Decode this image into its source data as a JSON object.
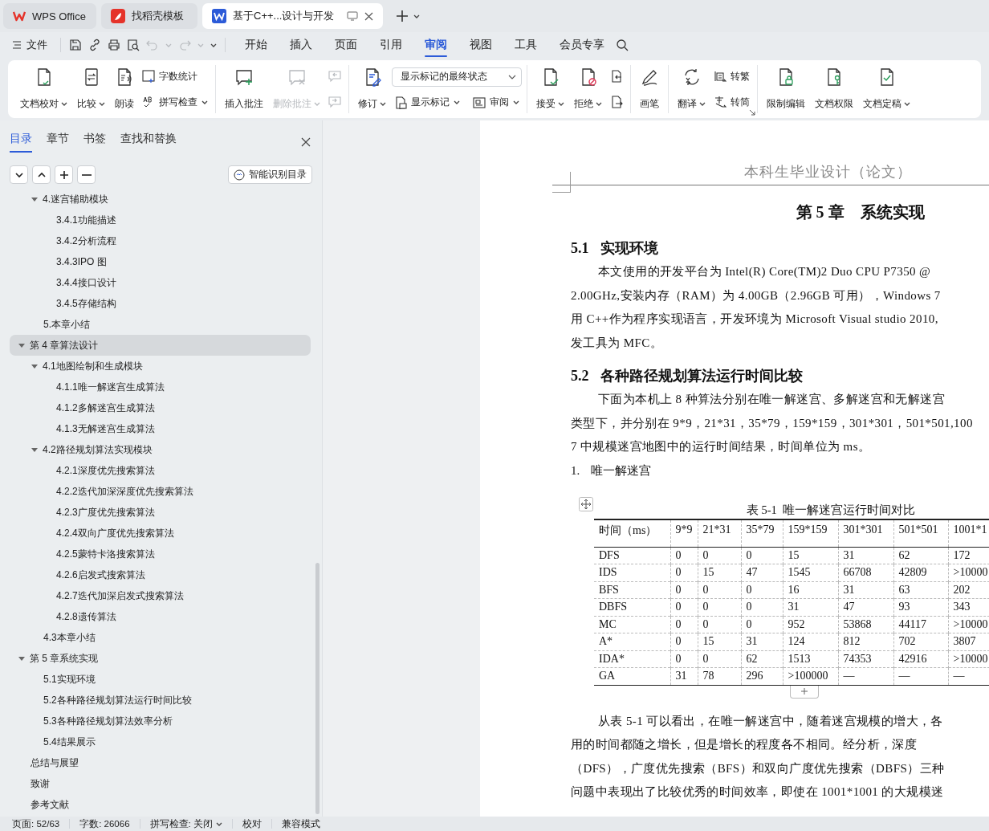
{
  "tabs": [
    {
      "kind": "home",
      "label": "WPS Office",
      "selected": false
    },
    {
      "kind": "template",
      "label": "找稻壳模板",
      "selected": false
    },
    {
      "kind": "document",
      "label": "基于C++...设计与开发",
      "selected": true
    }
  ],
  "menu": {
    "file": "文件",
    "quick_access": [
      {
        "disabled": false
      },
      {
        "disabled": false
      },
      {
        "disabled": false
      },
      {
        "disabled": false
      },
      {
        "disabled": true
      },
      {
        "disabled": true
      }
    ],
    "tabs": [
      {
        "label": "开始",
        "selected": false
      },
      {
        "label": "插入",
        "selected": false
      },
      {
        "label": "页面",
        "selected": false
      },
      {
        "label": "引用",
        "selected": false
      },
      {
        "label": "审阅",
        "selected": true
      },
      {
        "label": "视图",
        "selected": false
      },
      {
        "label": "工具",
        "selected": false
      },
      {
        "label": "会员专享",
        "selected": false
      }
    ]
  },
  "ribbon": {
    "groups": [
      {
        "launcher": false,
        "items": [
          {
            "kind": "large",
            "label": "文档校对",
            "caret": true,
            "disabled": false
          },
          {
            "kind": "large",
            "label": "比较",
            "caret": true,
            "disabled": false
          },
          {
            "kind": "large",
            "label": "朗读",
            "caret": false,
            "disabled": false
          },
          {
            "kind": "stack",
            "items": [
              {
                "kind": "button",
                "label": "字数统计",
                "caret": false,
                "disabled": false
              },
              {
                "kind": "button",
                "label": "拼写检查",
                "caret": true,
                "disabled": false
              }
            ]
          }
        ]
      },
      {
        "launcher": false,
        "items": [
          {
            "kind": "large",
            "label": "插入批注",
            "caret": false,
            "disabled": false
          },
          {
            "kind": "large",
            "label": "删除批注",
            "caret": true,
            "disabled": true
          },
          {
            "kind": "stack",
            "items": [
              {
                "kind": "button",
                "caret": false,
                "disabled": true
              },
              {
                "kind": "button",
                "caret": false,
                "disabled": true
              }
            ]
          }
        ]
      },
      {
        "launcher": false,
        "items": [
          {
            "kind": "large",
            "label": "修订",
            "caret": true,
            "disabled": false
          },
          {
            "kind": "stack",
            "items": [
              {
                "kind": "select",
                "value": "显示标记的最终状态"
              },
              {
                "kind": "pair",
                "items": [
                  {
                    "kind": "button",
                    "label": "显示标记",
                    "caret": true,
                    "disabled": false
                  },
                  {
                    "kind": "button",
                    "label": "审阅",
                    "caret": true,
                    "disabled": false
                  }
                ]
              }
            ]
          }
        ]
      },
      {
        "launcher": false,
        "items": [
          {
            "kind": "large",
            "label": "接受",
            "caret": true,
            "disabled": false
          },
          {
            "kind": "large",
            "label": "拒绝",
            "caret": true,
            "disabled": false
          },
          {
            "kind": "stack",
            "items": [
              {
                "kind": "button",
                "caret": false,
                "disabled": false
              },
              {
                "kind": "button",
                "caret": false,
                "disabled": false
              }
            ]
          }
        ]
      },
      {
        "launcher": false,
        "items": [
          {
            "kind": "large",
            "label": "画笔",
            "caret": false,
            "disabled": false
          }
        ]
      },
      {
        "launcher": true,
        "items": [
          {
            "kind": "large",
            "label": "翻译",
            "caret": true,
            "disabled": false
          },
          {
            "kind": "stack",
            "items": [
              {
                "kind": "button",
                "label": "转繁",
                "caret": false,
                "disabled": false
              },
              {
                "kind": "button",
                "label": "转简",
                "caret": false,
                "disabled": false
              }
            ]
          }
        ]
      },
      {
        "launcher": false,
        "items": [
          {
            "kind": "large",
            "label": "限制编辑",
            "caret": false,
            "disabled": false
          },
          {
            "kind": "large",
            "label": "文档权限",
            "caret": false,
            "disabled": false
          },
          {
            "kind": "large",
            "label": "文档定稿",
            "caret": true,
            "disabled": false
          }
        ]
      }
    ]
  },
  "nav_pane": {
    "tabs": [
      {
        "label": "目录",
        "selected": true
      },
      {
        "label": "章节",
        "selected": false
      },
      {
        "label": "书签",
        "selected": false
      },
      {
        "label": "查找和替换",
        "selected": false
      }
    ],
    "smart_button": "智能识别目录",
    "toc": {
      "continued": [
        {
          "label": "4.迷宫辅助模块",
          "expanded": true,
          "selected": false,
          "children": [
            {
              "label": "3.4.1功能描述",
              "selected": false
            },
            {
              "label": "3.4.2分析流程",
              "selected": false
            },
            {
              "label": "3.4.3IPO 图",
              "selected": false
            },
            {
              "label": "3.4.4接口设计",
              "selected": false
            },
            {
              "label": "3.4.5存储结构",
              "selected": false
            }
          ]
        },
        {
          "label": "5.本章小结",
          "selected": false
        }
      ],
      "items": [
        {
          "label": "第 4 章算法设计",
          "expanded": true,
          "selected": true,
          "children": [
            {
              "label": "4.1地图绘制和生成模块",
              "expanded": true,
              "selected": false,
              "children": [
                {
                  "label": "4.1.1唯一解迷宫生成算法",
                  "selected": false
                },
                {
                  "label": "4.1.2多解迷宫生成算法",
                  "selected": false
                },
                {
                  "label": "4.1.3无解迷宫生成算法",
                  "selected": false
                }
              ]
            },
            {
              "label": "4.2路径规划算法实现模块",
              "expanded": true,
              "selected": false,
              "children": [
                {
                  "label": "4.2.1深度优先搜索算法",
                  "selected": false
                },
                {
                  "label": "4.2.2迭代加深深度优先搜索算法",
                  "selected": false
                },
                {
                  "label": "4.2.3广度优先搜索算法",
                  "selected": false
                },
                {
                  "label": "4.2.4双向广度优先搜索算法",
                  "selected": false
                },
                {
                  "label": "4.2.5蒙特卡洛搜索算法",
                  "selected": false
                },
                {
                  "label": "4.2.6启发式搜索算法",
                  "selected": false
                },
                {
                  "label": "4.2.7迭代加深启发式搜索算法",
                  "selected": false
                },
                {
                  "label": "4.2.8遗传算法",
                  "selected": false
                }
              ]
            },
            {
              "label": "4.3本章小结",
              "selected": false
            }
          ]
        },
        {
          "label": "第 5 章系统实现",
          "expanded": true,
          "selected": false,
          "children": [
            {
              "label": "5.1实现环境",
              "selected": false
            },
            {
              "label": "5.2各种路径规划算法运行时间比较",
              "selected": false
            },
            {
              "label": "5.3各种路径规划算法效率分析",
              "selected": false
            },
            {
              "label": "5.4结果展示",
              "selected": false
            }
          ]
        },
        {
          "label": "总结与展望",
          "selected": false
        },
        {
          "label": "致谢",
          "selected": false
        },
        {
          "label": "参考文献",
          "selected": false
        }
      ]
    }
  },
  "document": {
    "header": "本科生毕业设计（论文）",
    "chapter_title": "第 5 章    系统实现",
    "blocks": [
      {
        "kind": "heading",
        "number": "5.1",
        "title": "实现环境"
      },
      {
        "kind": "paragraph",
        "lines": [
          "本文使用的开发平台为 Intel(R) Core(TM)2 Duo CPU P7350 @",
          "2.00GHz,安装内存（RAM）为 4.00GB（2.96GB 可用），Windows 7",
          "用 C++作为程序实现语言，开发环境为 Microsoft Visual studio 2010,",
          "发工具为 MFC。"
        ]
      },
      {
        "kind": "heading",
        "number": "5.2",
        "title": "各种路径规划算法运行时间比较"
      },
      {
        "kind": "paragraph",
        "lines": [
          "下面为本机上 8 种算法分别在唯一解迷宫、多解迷宫和无解迷宫",
          "类型下，并分别在 9*9，21*31，35*79，159*159，301*301，501*501,100",
          "7 中规模迷宫地图中的运行时间结果，时间单位为 ms。"
        ]
      },
      {
        "kind": "list_item",
        "number": "1.",
        "text": "唯一解迷宫"
      },
      {
        "kind": "table",
        "caption": "表 5-1  唯一解迷宫运行时间对比",
        "columns": [
          "时间（ms）",
          "9*9",
          "21*31",
          "35*79",
          "159*159",
          "301*301",
          "501*501",
          "1001*1"
        ],
        "rows": [
          [
            "DFS",
            "0",
            "0",
            "0",
            "15",
            "31",
            "62",
            "172"
          ],
          [
            "IDS",
            "0",
            "15",
            "47",
            "1545",
            "66708",
            "42809",
            ">10000"
          ],
          [
            "BFS",
            "0",
            "0",
            "0",
            "16",
            "31",
            "63",
            "202"
          ],
          [
            "DBFS",
            "0",
            "0",
            "0",
            "31",
            "47",
            "93",
            "343"
          ],
          [
            "MC",
            "0",
            "0",
            "0",
            "952",
            "53868",
            "44117",
            ">10000"
          ],
          [
            "A*",
            "0",
            "15",
            "31",
            "124",
            "812",
            "702",
            "3807"
          ],
          [
            "IDA*",
            "0",
            "0",
            "62",
            "1513",
            "74353",
            "42916",
            ">10000"
          ],
          [
            "GA",
            "31",
            "78",
            "296",
            ">100000",
            "—",
            "—",
            "—"
          ]
        ]
      },
      {
        "kind": "paragraph",
        "lines": [
          "从表 5-1 可以看出，在唯一解迷宫中，随着迷宫规模的增大，各",
          "用的时间都随之增长，但是增长的程度各不相同。经分析，深度",
          "（DFS），广度优先搜索（BFS）和双向广度优先搜索（DBFS）三种",
          "问题中表现出了比较优秀的时间效率，即使在 1001*1001 的大规模迷"
        ]
      }
    ]
  },
  "status_bar": {
    "items": [
      {
        "label": "页面: 52/63",
        "caret": false
      },
      {
        "label": "字数: 26066",
        "caret": false
      },
      {
        "label": "拼写检查: 关闭",
        "caret": true
      },
      {
        "label": "校对",
        "caret": false
      },
      {
        "label": "兼容模式",
        "caret": false
      }
    ]
  }
}
